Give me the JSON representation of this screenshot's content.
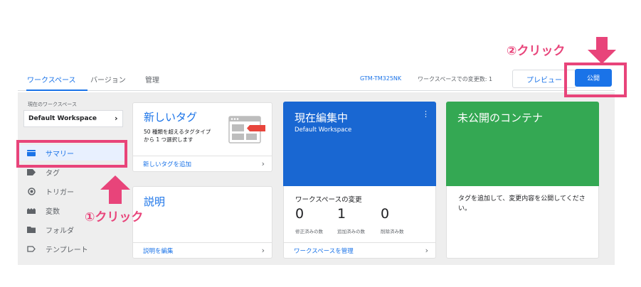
{
  "topnav": {
    "tabs": [
      {
        "label": "ワークスペース",
        "active": true
      },
      {
        "label": "バージョン",
        "active": false
      },
      {
        "label": "管理",
        "active": false
      }
    ],
    "container_id": "GTM-TM325NK",
    "changes_count": "ワークスペースでの変更数: 1",
    "preview_label": "プレビュー",
    "publish_label": "公開"
  },
  "sidebar": {
    "workspace_label": "現在のワークスペース",
    "workspace_name": "Default Workspace",
    "items": [
      {
        "label": "サマリー",
        "icon": "summary-icon",
        "active": true
      },
      {
        "label": "タグ",
        "icon": "tag-icon",
        "active": false
      },
      {
        "label": "トリガー",
        "icon": "trigger-icon",
        "active": false
      },
      {
        "label": "変数",
        "icon": "variables-icon",
        "active": false
      },
      {
        "label": "フォルダ",
        "icon": "folder-icon",
        "active": false
      },
      {
        "label": "テンプレート",
        "icon": "template-icon",
        "active": false
      }
    ]
  },
  "cards": {
    "new_tag": {
      "title": "新しいタグ",
      "desc": "50 種類を超えるタグタイプから 1 つ選択します",
      "link": "新しいタグを追加"
    },
    "description": {
      "title": "説明",
      "link": "説明を編集"
    },
    "editing": {
      "title": "現在編集中",
      "subtitle": "Default Workspace",
      "changes_title": "ワークスペースの変更",
      "stats": [
        {
          "value": "0",
          "label": "修正済みの数"
        },
        {
          "value": "1",
          "label": "追加済みの数"
        },
        {
          "value": "0",
          "label": "削除済み数"
        }
      ],
      "link": "ワークスペースを管理"
    },
    "unpublished": {
      "title": "未公開のコンテナ",
      "desc": "タグを追加して、変更内容を公開してください。"
    }
  },
  "annotations": {
    "step1": "①クリック",
    "step2": "②クリック"
  },
  "colors": {
    "accent": "#1a73e8",
    "editing_card": "#1967d2",
    "unpublished_card": "#34a853",
    "annotation": "#e8447a"
  }
}
